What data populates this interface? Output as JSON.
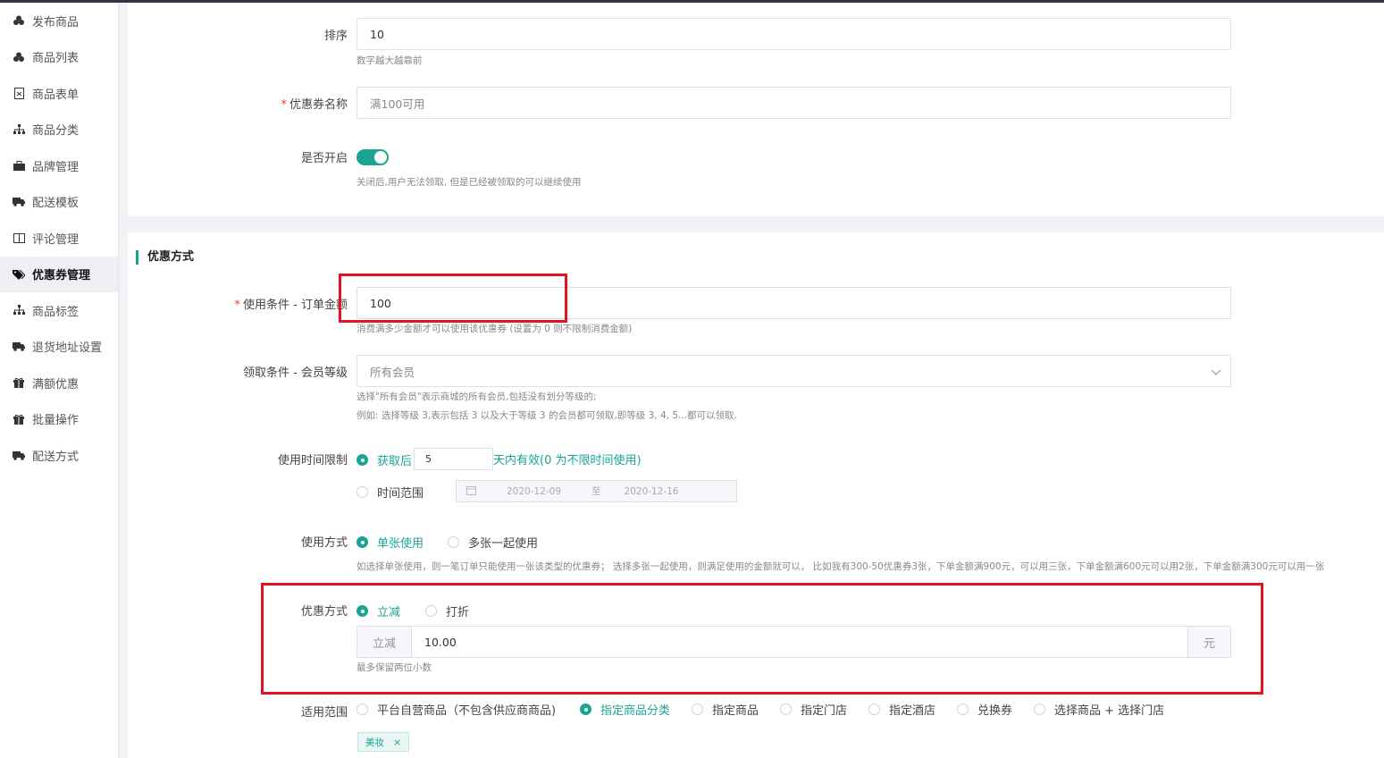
{
  "sidebar": {
    "items": [
      {
        "label": "发布商品",
        "icon": "cubes-icon"
      },
      {
        "label": "商品列表",
        "icon": "cubes-icon"
      },
      {
        "label": "商品表单",
        "icon": "form-icon"
      },
      {
        "label": "商品分类",
        "icon": "sitemap-icon"
      },
      {
        "label": "品牌管理",
        "icon": "briefcase-icon"
      },
      {
        "label": "配送模板",
        "icon": "truck-icon"
      },
      {
        "label": "评论管理",
        "icon": "columns-icon"
      },
      {
        "label": "优惠券管理",
        "icon": "tags-icon"
      },
      {
        "label": "商品标签",
        "icon": "sitemap-icon"
      },
      {
        "label": "退货地址设置",
        "icon": "truck-icon"
      },
      {
        "label": "满额优惠",
        "icon": "gift-icon"
      },
      {
        "label": "批量操作",
        "icon": "gift-icon"
      },
      {
        "label": "配送方式",
        "icon": "truck-icon"
      }
    ],
    "active_index": 7
  },
  "basic": {
    "sort_label": "排序",
    "sort_value": "10",
    "sort_hint": "数字越大越靠前",
    "name_label": "优惠券名称",
    "name_value": "满100可用",
    "enable_label": "是否开启",
    "enable_on": true,
    "enable_hint": "关闭后,用户无法领取, 但是已经被领取的可以继续使用"
  },
  "discount": {
    "section_title": "优惠方式",
    "condition_label": "使用条件 - 订单金额",
    "condition_value": "100",
    "condition_hint": "消费满多少金额才可以使用该优惠券 (设置为 0 则不限制消费金额)",
    "level_label": "领取条件 - 会员等级",
    "level_value": "所有会员",
    "level_hint1": "选择\"所有会员\"表示商城的所有会员,包括没有划分等级的;",
    "level_hint2": "例如: 选择等级 3,表示包括 3 以及大于等级 3 的会员都可领取,即等级 3, 4, 5...都可以领取.",
    "time_label": "使用时间限制",
    "time_opt1_prefix": "获取后",
    "time_days": "5",
    "time_opt1_suffix": "天内有效(0 为不限时间使用)",
    "time_opt2": "时间范围",
    "date_start": "2020-12-09",
    "date_to": "至",
    "date_end": "2020-12-16",
    "usage_label": "使用方式",
    "usage_opt1": "单张使用",
    "usage_opt2": "多张一起使用",
    "usage_hint": "如选择单张使用，则一笔订单只能使用一张该类型的优惠券；  选择多张一起使用，则满足使用的金额就可以，  比如我有300-50优惠券3张，下单金额满900元，可以用三张，下单金额满600元可以用2张，下单金额满300元可以用一张",
    "mode_label": "优惠方式",
    "mode_opt1": "立减",
    "mode_opt2": "打折",
    "amount_prefix": "立减",
    "amount_value": "10.00",
    "amount_suffix": "元",
    "amount_hint": "最多保留两位小数",
    "scope_label": "适用范围",
    "scope_options": [
      "平台自营商品（不包含供应商商品)",
      "指定商品分类",
      "指定商品",
      "指定门店",
      "指定酒店",
      "兑换券",
      "选择商品 + 选择门店"
    ],
    "scope_selected": 1,
    "tag_label": "美妆",
    "tag_close": "×"
  },
  "colors": {
    "accent": "#1aa494",
    "highlight": "#e3141f"
  }
}
